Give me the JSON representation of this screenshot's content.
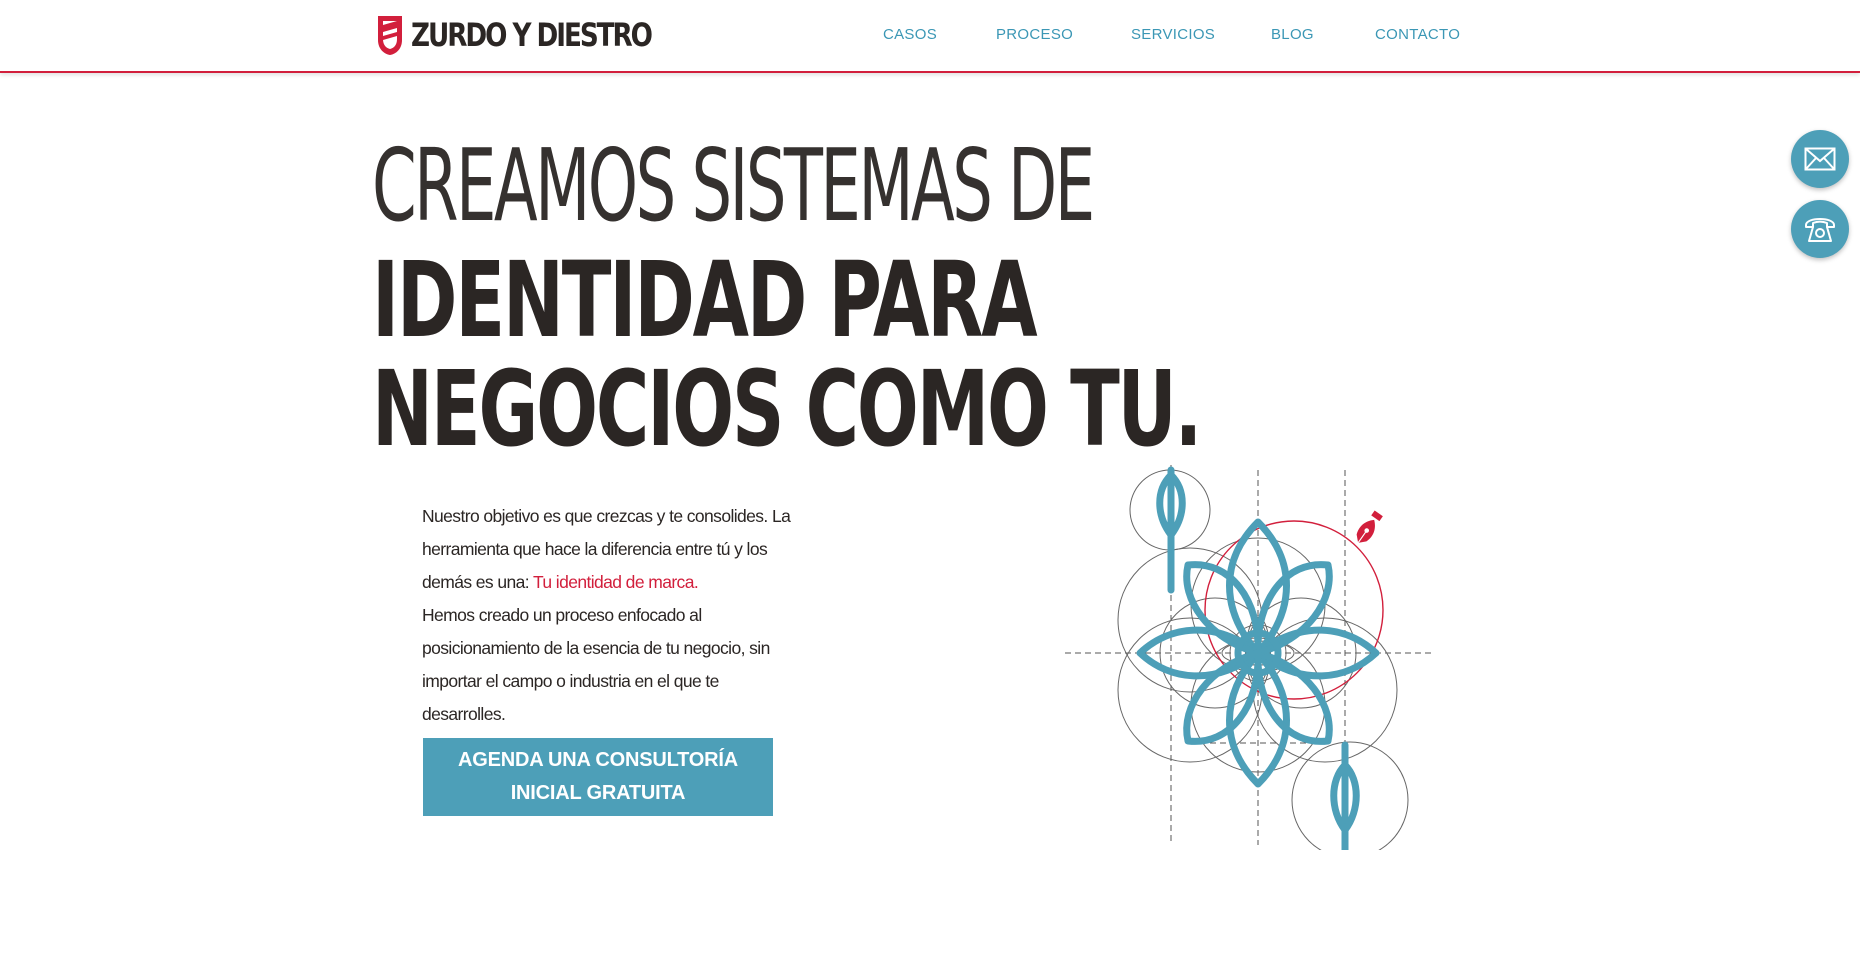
{
  "brand": {
    "name": "ZURDO Y DIESTRO",
    "accent": "#d21f3c",
    "primary": "#4d9fb8",
    "text": "#2b2624"
  },
  "nav": {
    "items": [
      {
        "label": "CASOS"
      },
      {
        "label": "PROCESO"
      },
      {
        "label": "SERVICIOS"
      },
      {
        "label": "BLOG"
      },
      {
        "label": "CONTACTO"
      }
    ]
  },
  "floating": {
    "email_icon": "envelope-icon",
    "phone_icon": "phone-icon"
  },
  "hero": {
    "line1": "CREAMOS SISTEMAS DE",
    "line2": "IDENTIDAD PARA",
    "line3": "NEGOCIOS COMO TU."
  },
  "intro": {
    "p1_before": "Nuestro objetivo es que crezcas y te consolides. La herramienta que hace la diferencia entre tú y los demás es una: ",
    "p1_highlight": "Tu identidad de marca.",
    "p2": "Hemos creado un proceso enfocado al posicionamiento de la esencia de tu negocio, sin importar el campo o industria en el que te desarrolles."
  },
  "cta": {
    "line1": "AGENDA UNA CONSULTORÍA",
    "line2": "INICIAL GRATUITA"
  },
  "illustration": {
    "icon": "pen-nib-icon"
  }
}
